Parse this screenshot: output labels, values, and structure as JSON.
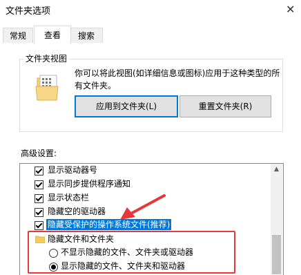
{
  "window": {
    "title": "文件夹选项"
  },
  "tabs": [
    {
      "label": "常规",
      "active": false
    },
    {
      "label": "查看",
      "active": true
    },
    {
      "label": "搜索",
      "active": false
    }
  ],
  "folder_view": {
    "group_title": "文件夹视图",
    "description": "你可以将此视图(如详细信息或图标)应用于这种类型的所有文件夹。",
    "apply_button": "应用到文件夹(L)",
    "reset_button": "重置文件夹(R)"
  },
  "advanced": {
    "label": "高级设置:",
    "items": [
      {
        "label": "显示驱动器号",
        "checked": true
      },
      {
        "label": "显示同步提供程序通知",
        "checked": true
      },
      {
        "label": "显示状态栏",
        "checked": true
      },
      {
        "label": "隐藏空的驱动器",
        "checked": true
      },
      {
        "label": "隐藏受保护的操作系统文件(推荐)",
        "checked": true,
        "selected": true
      },
      {
        "label": "隐藏文件和文件夹",
        "type": "folder"
      },
      {
        "label": "不显示隐藏的文件、文件夹或驱动器",
        "type": "radio",
        "selected": false
      },
      {
        "label": "显示隐藏的文件、文件夹和驱动器",
        "type": "radio",
        "selected": true
      }
    ]
  },
  "colors": {
    "selection": "#0078d7",
    "annotation": "#e5383b"
  }
}
